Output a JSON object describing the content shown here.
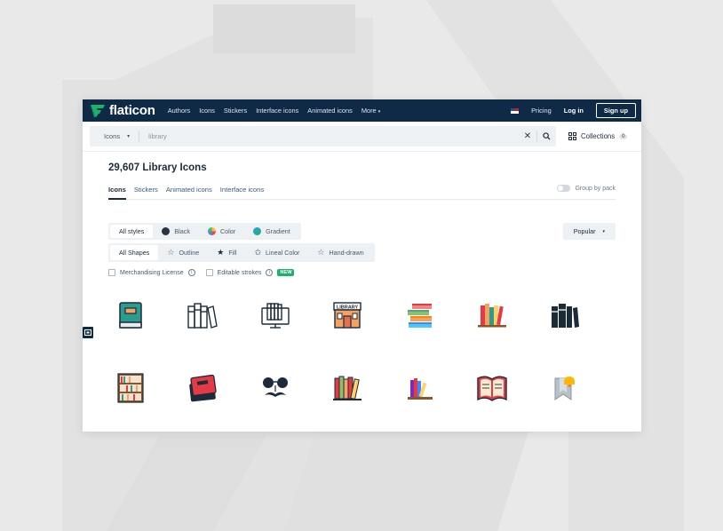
{
  "colors": {
    "navy": "#0e2a47",
    "brand_green": "#1bb36b",
    "panel": "#eef1f4"
  },
  "header": {
    "logo_text": "flaticon",
    "nav": [
      "Authors",
      "Icons",
      "Stickers",
      "Interface icons",
      "Animated icons",
      "More"
    ],
    "pricing": "Pricing",
    "login": "Log in",
    "signup": "Sign up"
  },
  "search": {
    "type": "Icons",
    "value": "library",
    "collections_label": "Collections",
    "collections_count": "0"
  },
  "main": {
    "title": "29,607 Library Icons",
    "tabs": [
      "Icons",
      "Stickers",
      "Animated icons",
      "Interface icons"
    ],
    "group_by_pack": "Group by pack",
    "styles": [
      "All styles",
      "Black",
      "Color",
      "Gradient"
    ],
    "shapes": [
      "All Shapes",
      "Outline",
      "Fill",
      "Lineal Color",
      "Hand-drawn"
    ],
    "sort": "Popular",
    "merch_license": "Merchandising License",
    "editable_strokes": "Editable strokes",
    "new_badge": "NEW"
  },
  "icons": [
    "green-book-icon",
    "books-outline-icon",
    "computer-books-icon",
    "library-building-icon",
    "stacked-books-icon",
    "books-shelf-color-icon",
    "black-books-icon",
    "bookcase-icon",
    "red-books-icon",
    "sunglasses-mustache-icon",
    "books-row-icon",
    "books-on-shelf-icon",
    "open-book-icon",
    "bookmark-bell-icon"
  ]
}
